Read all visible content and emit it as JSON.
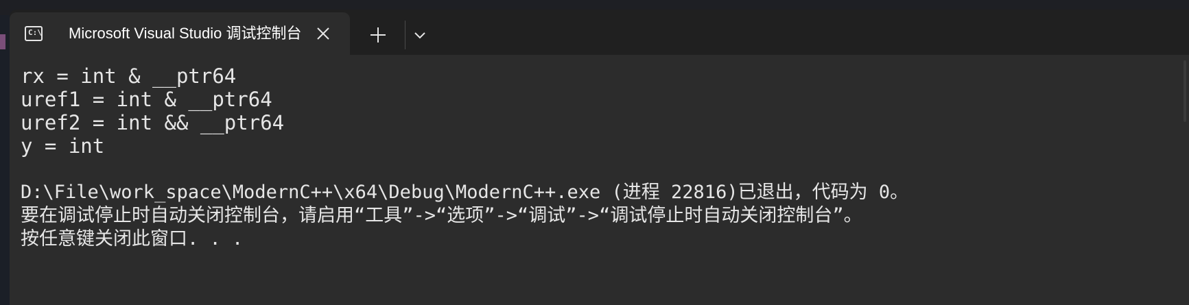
{
  "window": {
    "tab": {
      "icon": "terminal-icon",
      "title": "Microsoft Visual Studio 调试控制台",
      "close_icon": "close-icon"
    },
    "new_tab_icon": "plus-icon",
    "dropdown_icon": "chevron-down-icon"
  },
  "terminal": {
    "lines": [
      "rx = int & __ptr64",
      "uref1 = int & __ptr64",
      "uref2 = int && __ptr64",
      "y = int",
      "",
      "D:\\File\\work_space\\ModernC++\\x64\\Debug\\ModernC++.exe (进程 22816)已退出，代码为 0。",
      "要在调试停止时自动关闭控制台，请启用“工具”->“选项”->“调试”->“调试停止时自动关闭控制台”。",
      "按任意键关闭此窗口. . ."
    ]
  },
  "colors": {
    "tab_bar": "#202020",
    "active_tab": "#2c2c2c",
    "terminal_bg": "#2c2c2c",
    "text": "#e6e6e6"
  }
}
